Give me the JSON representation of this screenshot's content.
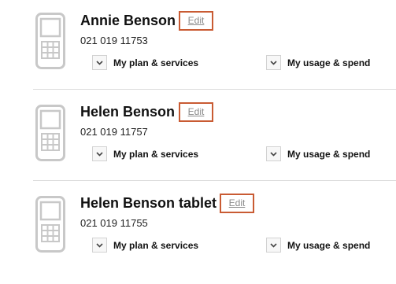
{
  "accounts": [
    {
      "name": "Annie Benson",
      "edit_label": "Edit",
      "number": "021 019 11753",
      "plan_label": "My plan & services",
      "usage_label": "My usage & spend"
    },
    {
      "name": "Helen Benson",
      "edit_label": "Edit",
      "number": "021 019 11757",
      "plan_label": "My plan & services",
      "usage_label": "My usage & spend"
    },
    {
      "name": "Helen Benson tablet",
      "edit_label": "Edit",
      "number": "021 019 11755",
      "plan_label": "My plan & services",
      "usage_label": "My usage & spend"
    }
  ],
  "icons": {
    "device": "mobile-phone-icon",
    "expand": "chevron-down-icon"
  },
  "colors": {
    "edit_border": "#c95b33",
    "edit_text": "#8a8a8a",
    "icon_gray": "#c8c8c8",
    "divider": "#dcdcdc"
  }
}
